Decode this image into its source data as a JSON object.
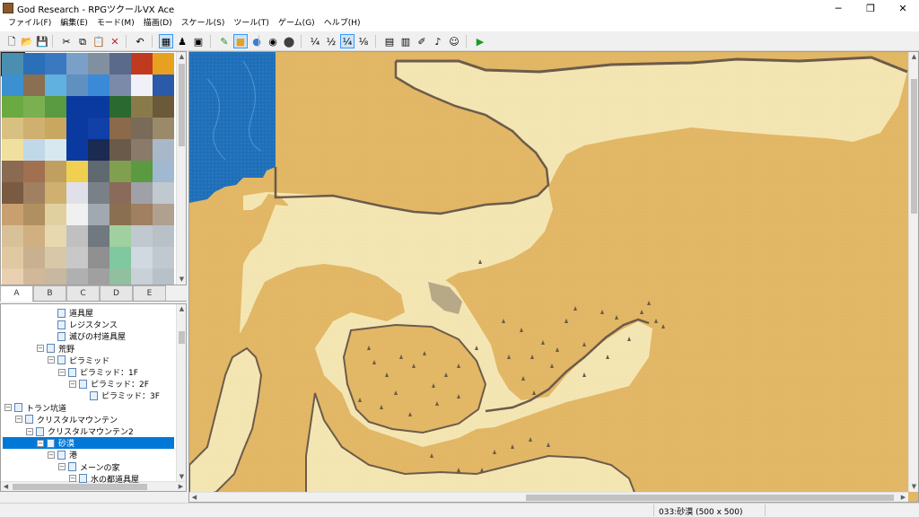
{
  "window": {
    "title": "God Research - RPGツクールVX Ace",
    "minimize": "─",
    "restore": "❐",
    "close": "✕"
  },
  "menu": [
    "ファイル(F)",
    "編集(E)",
    "モード(M)",
    "描画(D)",
    "スケール(S)",
    "ツール(T)",
    "ゲーム(G)",
    "ヘルプ(H)"
  ],
  "toolbar": {
    "buttons": [
      {
        "name": "new-project-icon",
        "glyph": "🗋"
      },
      {
        "name": "open-project-icon",
        "glyph": "📂"
      },
      {
        "name": "save-project-icon",
        "glyph": "💾"
      },
      {
        "name": "cut-icon",
        "glyph": "✂"
      },
      {
        "name": "copy-icon",
        "glyph": "⧉"
      },
      {
        "name": "paste-icon",
        "glyph": "📋"
      },
      {
        "name": "delete-icon",
        "glyph": "✕"
      },
      {
        "name": "undo-icon",
        "glyph": "↶"
      },
      {
        "name": "map-mode-icon",
        "glyph": "▦"
      },
      {
        "name": "event-mode-icon",
        "glyph": "♟"
      },
      {
        "name": "region-mode-icon",
        "glyph": "▣"
      },
      {
        "name": "pencil-icon",
        "glyph": "✎"
      },
      {
        "name": "rectangle-icon",
        "glyph": "■"
      },
      {
        "name": "ellipse-icon",
        "glyph": "●"
      },
      {
        "name": "fill-icon",
        "glyph": "◉"
      },
      {
        "name": "shadow-pen-icon",
        "glyph": "⬤"
      },
      {
        "name": "scale-1-1-icon",
        "glyph": "¼"
      },
      {
        "name": "scale-1-2-icon",
        "glyph": "½"
      },
      {
        "name": "scale-1-4-icon",
        "glyph": "¼"
      },
      {
        "name": "scale-1-8-icon",
        "glyph": "⅛"
      },
      {
        "name": "database-icon",
        "glyph": "▤"
      },
      {
        "name": "resource-manager-icon",
        "glyph": "▥"
      },
      {
        "name": "script-editor-icon",
        "glyph": "✐"
      },
      {
        "name": "sound-test-icon",
        "glyph": "♪"
      },
      {
        "name": "character-generator-icon",
        "glyph": "☺"
      },
      {
        "name": "playtest-icon",
        "glyph": "▶"
      }
    ]
  },
  "tileset_tabs": [
    "A",
    "B",
    "C",
    "D",
    "E"
  ],
  "tree": [
    {
      "indent": 4,
      "label": "道具屋",
      "exp": ""
    },
    {
      "indent": 4,
      "label": "レジスタンス",
      "exp": ""
    },
    {
      "indent": 4,
      "label": "滅びの村道具屋",
      "exp": ""
    },
    {
      "indent": 3,
      "label": "荒野",
      "exp": "−"
    },
    {
      "indent": 4,
      "label": "ピラミッド",
      "exp": "−"
    },
    {
      "indent": 5,
      "label": "ピラミッド：1F",
      "exp": "−"
    },
    {
      "indent": 6,
      "label": "ピラミッド：2F",
      "exp": "−"
    },
    {
      "indent": 7,
      "label": "ピラミッド：3F",
      "exp": ""
    },
    {
      "indent": 0,
      "label": "トラン坑道",
      "exp": "−"
    },
    {
      "indent": 1,
      "label": "クリスタルマウンテン",
      "exp": "−"
    },
    {
      "indent": 2,
      "label": "クリスタルマウンテン2",
      "exp": "−"
    },
    {
      "indent": 3,
      "label": "砂漠",
      "exp": "−",
      "selected": true
    },
    {
      "indent": 4,
      "label": "港",
      "exp": "−"
    },
    {
      "indent": 5,
      "label": "メーンの家",
      "exp": "−"
    },
    {
      "indent": 6,
      "label": "水の都道具屋",
      "exp": "−"
    }
  ],
  "status": {
    "map_info": "033:砂漠 (500 x 500)"
  },
  "colors": {
    "sand": "#e2b765",
    "light_sand": "#f4e6b3",
    "cliff": "#6b5a4a",
    "water": "#1e6fba",
    "selection": "#0078d7"
  }
}
